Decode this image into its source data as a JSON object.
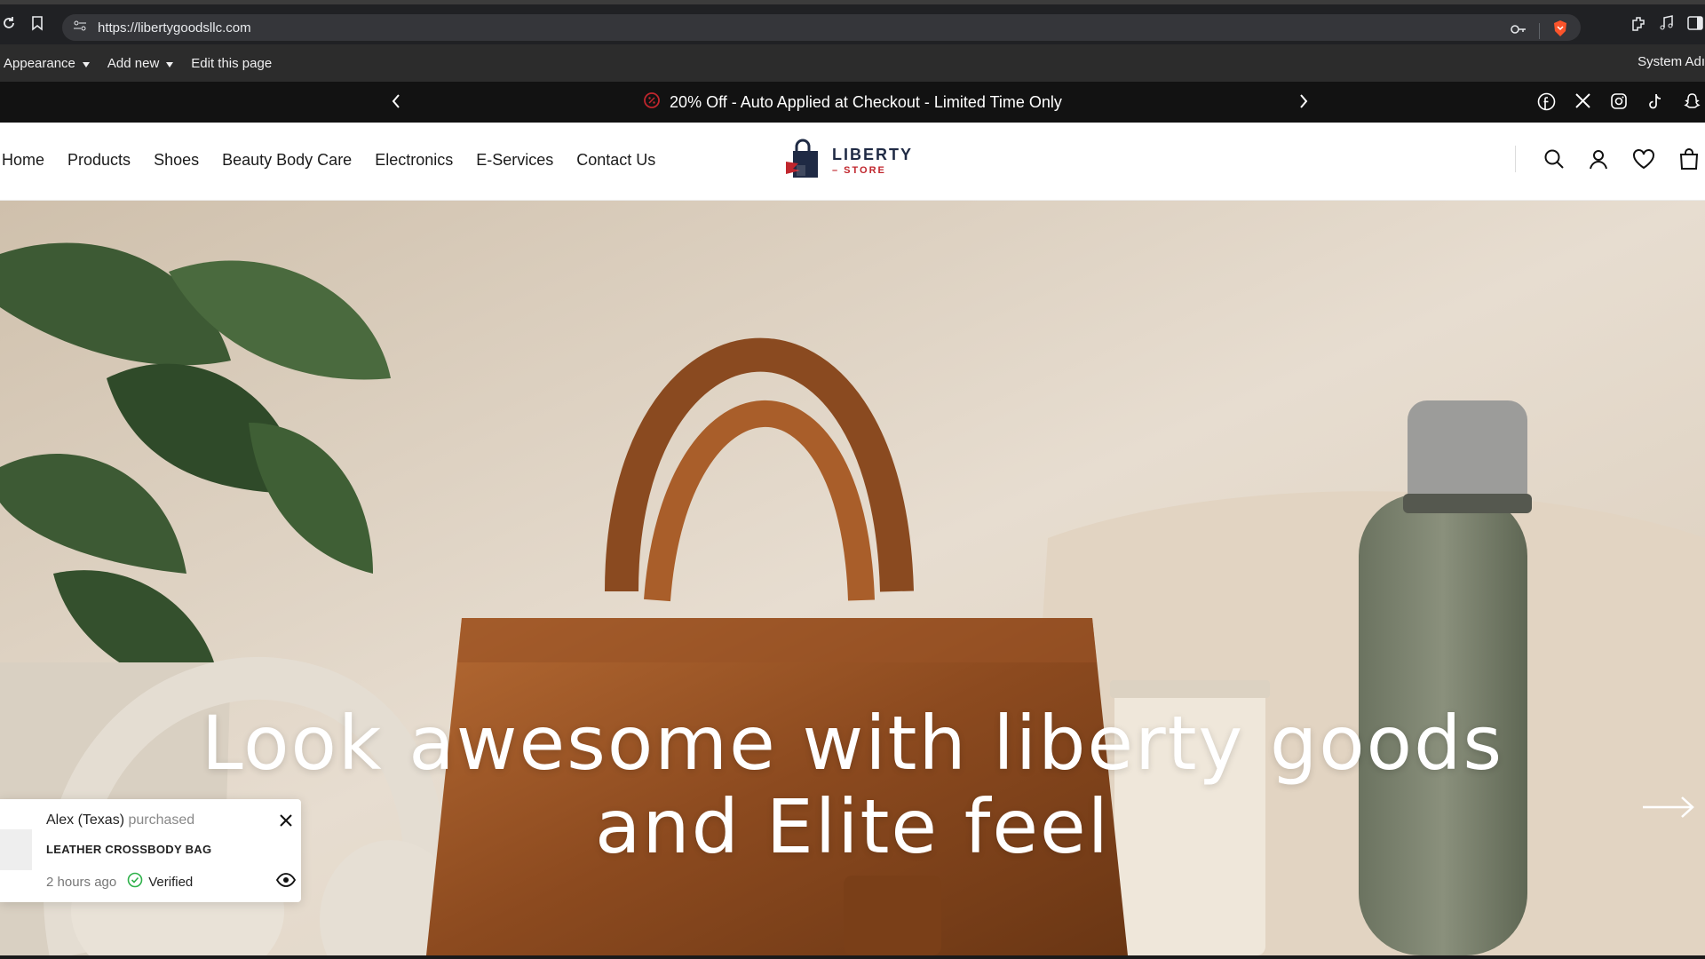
{
  "browser": {
    "url": "https://libertygoodsllc.com"
  },
  "admin_bar": {
    "appearance": "Appearance",
    "add_new": "Add new",
    "edit_page": "Edit this page",
    "user": "System Adı"
  },
  "announcement": {
    "text": "20% Off - Auto Applied at Checkout - Limited Time Only"
  },
  "nav": {
    "items": [
      "Home",
      "Products",
      "Shoes",
      "Beauty Body Care",
      "Electronics",
      "E-Services",
      "Contact Us"
    ]
  },
  "logo": {
    "word": "LIBERTY",
    "sub": "– STORE"
  },
  "hero": {
    "line1": "Look awesome with liberty goods",
    "line2": "and Elite feel"
  },
  "popup": {
    "name": "Alex (Texas)",
    "action": "purchased",
    "product": "LEATHER CROSSBODY BAG",
    "time": "2 hours ago",
    "verified": "Verified"
  },
  "colors": {
    "accent_red": "#c0262d",
    "logo_navy": "#1f2a44",
    "announce_bg": "#121212",
    "verified_green": "#2eb14a"
  }
}
